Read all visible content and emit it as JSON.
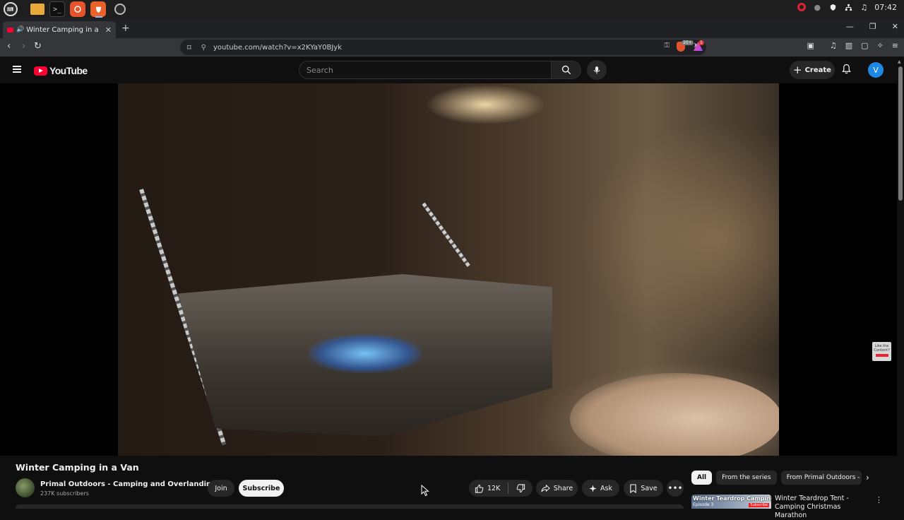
{
  "os": {
    "clock": "07:42",
    "taskbar_apps": [
      "menu-icon",
      "files-icon",
      "terminal-icon",
      "firefox-icon",
      "brave-icon",
      "chrome-icon"
    ],
    "terminal_glyph": ">_"
  },
  "browser": {
    "tab_title": "Winter Camping in a Van -",
    "url": "youtube.com/watch?v=x2KYaY0BJyk",
    "shield_badge": "20+",
    "rewards_badge": "1"
  },
  "youtube": {
    "logo_text": "YouTube",
    "search_placeholder": "Search",
    "create_label": "Create",
    "avatar_letter": "V"
  },
  "video": {
    "title": "Winter Camping in a Van",
    "watermark_text": "Like the Content?",
    "watermark_sub": "Subscribe"
  },
  "channel": {
    "name": "Primal Outdoors - Camping and Overlanding",
    "subscribers": "237K subscribers",
    "join_label": "Join",
    "subscribe_label": "Subscribe"
  },
  "actions": {
    "likes": "12K",
    "share_label": "Share",
    "ask_label": "Ask",
    "save_label": "Save"
  },
  "chips": [
    {
      "label": "All",
      "active": true
    },
    {
      "label": "From the series",
      "active": false
    },
    {
      "label": "From Primal Outdoors - C",
      "active": false
    }
  ],
  "recommendation": {
    "thumb_title": "Winter Teardrop Camping",
    "thumb_episode": "Episode 3",
    "thumb_sub": "Subscribe",
    "title": "Winter Teardrop Tent - Camping Christmas Marathon"
  }
}
